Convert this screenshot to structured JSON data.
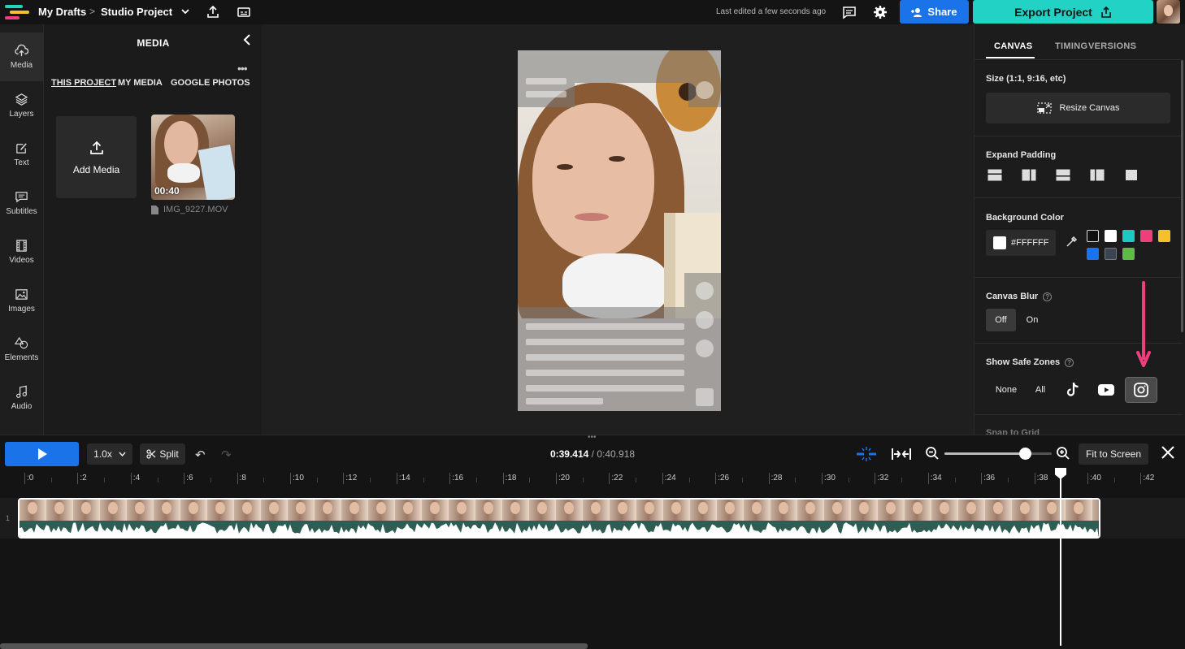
{
  "header": {
    "breadcrumb_root": "My Drafts",
    "breadcrumb_sep": ">",
    "project_name": "Studio Project",
    "last_edited": "Last edited a few seconds ago",
    "share_label": "Share",
    "export_label": "Export Project"
  },
  "rail": {
    "items": [
      {
        "label": "Media",
        "icon": "upload-cloud-icon"
      },
      {
        "label": "Layers",
        "icon": "layers-icon"
      },
      {
        "label": "Text",
        "icon": "text-edit-icon"
      },
      {
        "label": "Subtitles",
        "icon": "subtitles-icon"
      },
      {
        "label": "Videos",
        "icon": "film-icon"
      },
      {
        "label": "Images",
        "icon": "image-icon"
      },
      {
        "label": "Elements",
        "icon": "shapes-icon"
      },
      {
        "label": "Audio",
        "icon": "music-note-icon"
      }
    ]
  },
  "media": {
    "title": "MEDIA",
    "more": "•••",
    "tabs": [
      "THIS PROJECT",
      "MY MEDIA",
      "GOOGLE PHOTOS"
    ],
    "add_media_label": "Add Media",
    "file": {
      "duration": "00:40",
      "name": "IMG_9227.MOV"
    }
  },
  "right_panel": {
    "tabs": [
      "CANVAS",
      "TIMING",
      "VERSIONS"
    ],
    "size_label": "Size (1:1, 9:16, etc)",
    "resize_label": "Resize Canvas",
    "padding_label": "Expand Padding",
    "bg_label": "Background Color",
    "bg_hex": "#FFFFFF",
    "swatches": [
      "#111111",
      "#FFFFFF",
      "#1CC9C4",
      "#EE3E7C",
      "#F5C02A",
      "#1A73E8",
      "#3C4352",
      "#5DBB46"
    ],
    "blur_label": "Canvas Blur",
    "blur_off": "Off",
    "blur_on": "On",
    "safe_zones_label": "Show Safe Zones",
    "safe_none": "None",
    "safe_all": "All",
    "safe_selected": "instagram",
    "snap_label": "Snap to Grid",
    "help_glyph": "?"
  },
  "timeline": {
    "speed": "1.0x",
    "split_label": "Split",
    "current_time": "0:39.414",
    "total_time": "/ 0:40.918",
    "fit_label": "Fit to Screen",
    "track_number": "1",
    "zoom_level": 0.75,
    "ticks": [
      ":0",
      ":2",
      ":4",
      ":6",
      ":8",
      ":10",
      ":12",
      ":14",
      ":16",
      ":18",
      ":20",
      ":22",
      ":24",
      ":26",
      ":28",
      ":30",
      ":32",
      ":34",
      ":36",
      ":38",
      ":40",
      ":42"
    ]
  },
  "colors": {
    "accent_blue": "#1A73E8",
    "export_teal": "#22D3C5",
    "annotation_pink": "#EE3E7C"
  }
}
